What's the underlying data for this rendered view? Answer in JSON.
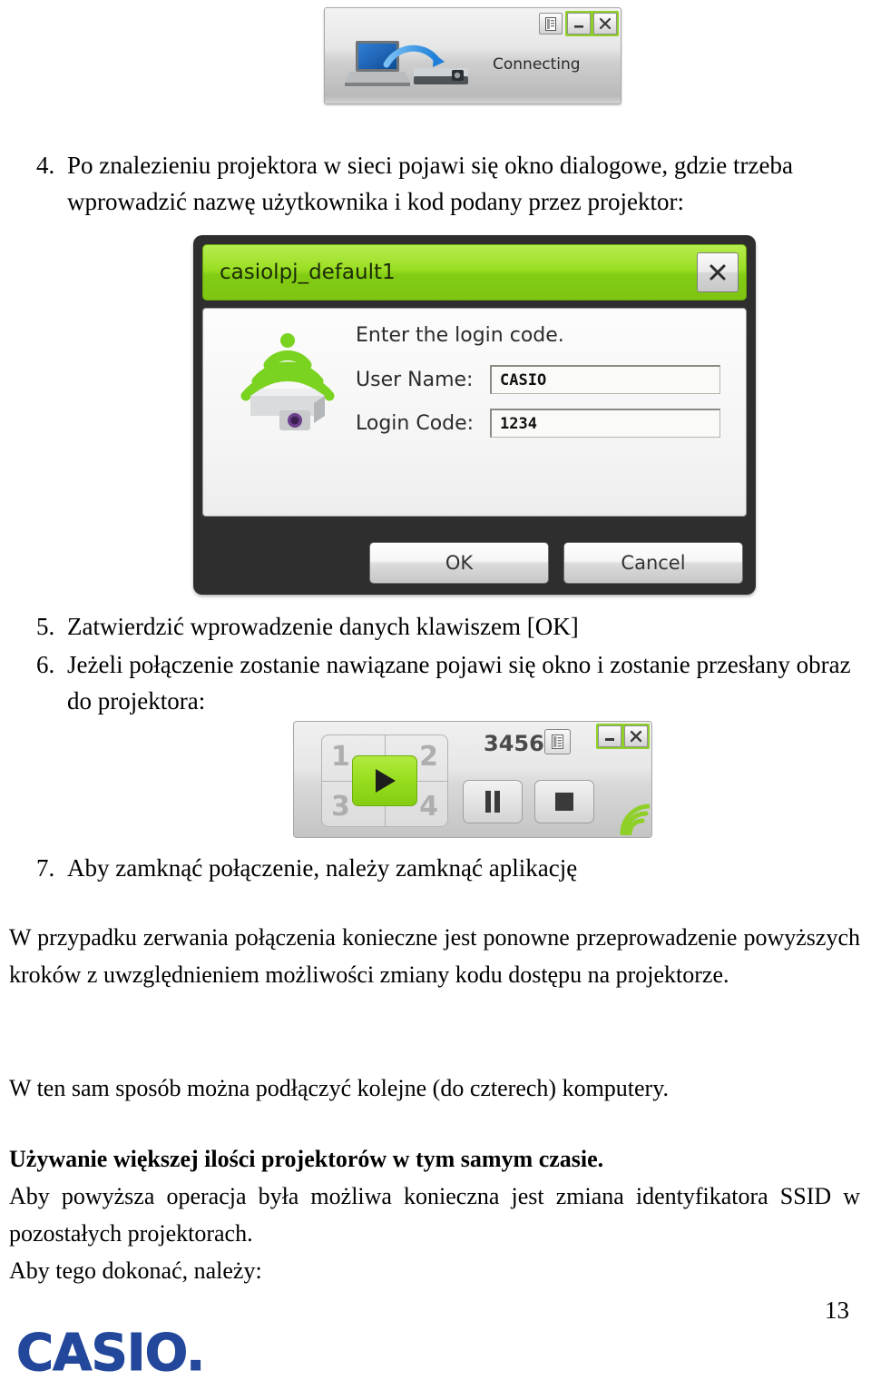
{
  "document": {
    "page_number": "13",
    "language": "pl"
  },
  "connecting_window": {
    "status_label": "Connecting",
    "icon": "laptop-to-projector-icon",
    "buttons": {
      "list": "list-icon",
      "minimize": "minimize-icon",
      "close": "close-icon"
    },
    "accent_color": "#8ed028"
  },
  "steps": [
    {
      "number": "4.",
      "text": "Po znalezieniu projektora w sieci pojawi się okno dialogowe, gdzie trzeba wprowadzić nazwę użytkownika i kod podany przez projektor:"
    },
    {
      "number": "5.",
      "text": "Zatwierdzić wprowadzenie danych klawiszem [OK]"
    },
    {
      "number": "6.",
      "text": "Jeżeli połączenie zostanie nawiązane pojawi się okno i zostanie przesłany obraz do projektora:"
    },
    {
      "number": "7.",
      "text": "Aby zamknąć połączenie, należy zamknąć aplikację"
    }
  ],
  "login_dialog": {
    "title": "casiolpj_default1",
    "close_label": "✕",
    "prompt": "Enter the login code.",
    "icon": "projector-wifi-icon",
    "fields": [
      {
        "label": "User Name:",
        "value": "CASIO",
        "name": "user-name-field"
      },
      {
        "label": "Login Code:",
        "value": "1234",
        "name": "login-code-field"
      }
    ],
    "ok_label": "OK",
    "cancel_label": "Cancel",
    "titlebar_color": "#9ade22"
  },
  "playback_window": {
    "code": "3456",
    "quadrant_labels": [
      "1",
      "2",
      "3",
      "4"
    ],
    "play_label": "play-icon",
    "pause_label": "pause-icon",
    "stop_label": "stop-icon",
    "list_label": "list-icon",
    "minimize_label": "minimize-icon",
    "close_label": "close-icon",
    "accent_color": "#8ed028"
  },
  "paragraphs": {
    "p1": "W przypadku zerwania połączenia konieczne jest ponowne przeprowadzenie powyższych kroków z uwzględnieniem możliwości zmiany kodu dostępu na projektorze.",
    "p2": "W ten sam sposób można podłączyć kolejne (do czterech) komputery.",
    "heading": "Używanie większej ilości projektorów w tym samym czasie.",
    "p3": "Aby powyższa operacja była możliwa konieczna jest zmiana identyfikatora SSID w pozostałych projektorach.",
    "p4": "Aby tego dokonać, należy:"
  },
  "footer": {
    "logo_text": "CASIO",
    "logo_dot": ".",
    "logo_color": "#22479b"
  }
}
